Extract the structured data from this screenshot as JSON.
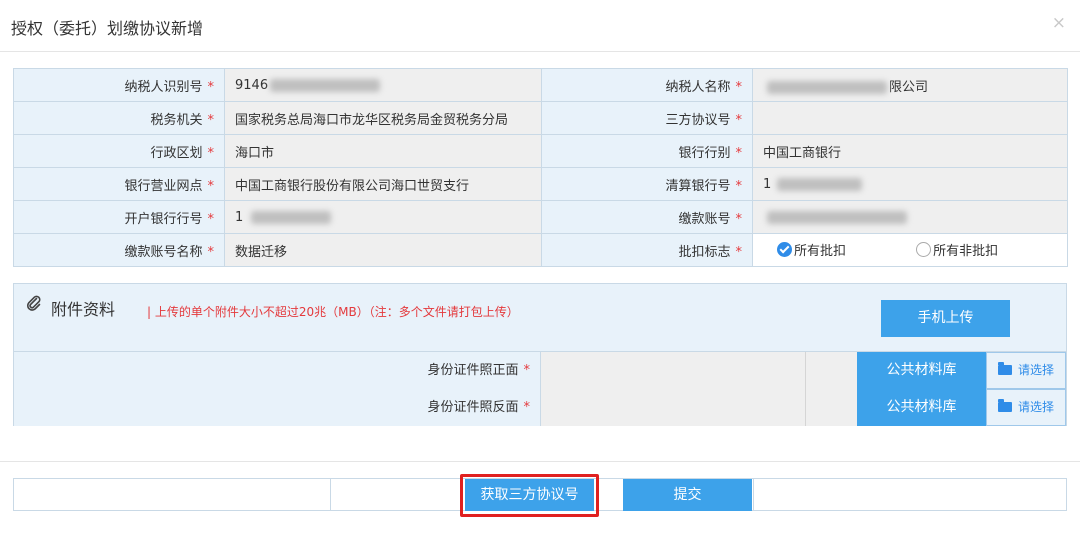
{
  "dialog": {
    "title": "授权（委托）划缴协议新增",
    "close_label": "×"
  },
  "form": {
    "required_mark": "*",
    "taxpayer_id": {
      "label": "纳税人识别号",
      "value": "9146"
    },
    "taxpayer_name": {
      "label": "纳税人名称",
      "value": "限公司"
    },
    "tax_authority": {
      "label": "税务机关",
      "value": "国家税务总局海口市龙华区税务局金贸税务分局"
    },
    "agreement_no": {
      "label": "三方协议号",
      "value": ""
    },
    "admin_region": {
      "label": "行政区划",
      "value": "海口市"
    },
    "bank_type": {
      "label": "银行行别",
      "value": "中国工商银行"
    },
    "bank_branch": {
      "label": "银行营业网点",
      "value": "中国工商银行股份有限公司海口世贸支行"
    },
    "clearing_bank_no": {
      "label": "清算银行号",
      "value": "1"
    },
    "account_bank_no": {
      "label": "开户银行行号",
      "value": "1"
    },
    "payment_account": {
      "label": "缴款账号",
      "value": ""
    },
    "account_name": {
      "label": "缴款账号名称",
      "value": "数据迁移"
    },
    "deduction_flag": {
      "label": "批扣标志",
      "options": [
        "所有批扣",
        "所有非批扣"
      ],
      "selected": "所有批扣"
    }
  },
  "attachments": {
    "title": "附件资料",
    "note": "| 上传的单个附件大小不超过20兆（MB）（注：多个文件请打包上传）",
    "mobile_upload": "手机上传",
    "rows": [
      {
        "label": "身份证件照正面",
        "library": "公共材料库",
        "choose": "请选择"
      },
      {
        "label": "身份证件照反面",
        "library": "公共材料库",
        "choose": "请选择"
      }
    ]
  },
  "footer": {
    "fetch_button": "获取三方协议号",
    "submit_button": "提交"
  },
  "colors": {
    "label_bg": "#e8f2fa",
    "value_bg": "#efefef",
    "primary_button": "#3da2ea",
    "required": "#e4393c",
    "highlight_frame": "#e02020"
  }
}
